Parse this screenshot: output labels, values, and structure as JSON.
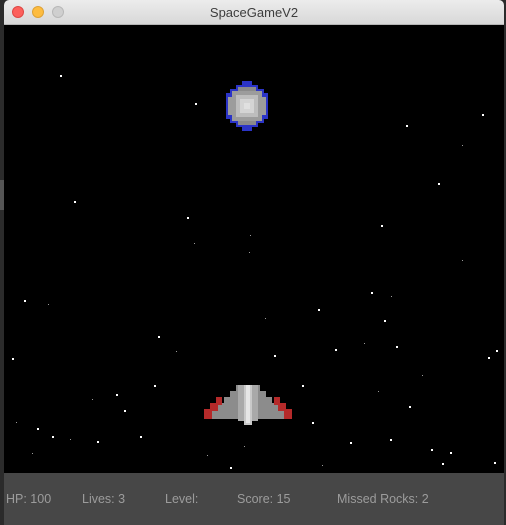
{
  "window": {
    "title": "SpaceGameV2"
  },
  "hud": {
    "hp": "HP: 100",
    "lives": "Lives: 3",
    "level": "Level:",
    "score": "Score: 15",
    "missed": "Missed Rocks: 2"
  },
  "colors": {
    "background": "#000000",
    "hud_bg": "#474747",
    "hud_text": "#9c9c9c",
    "ship_hull": "#a9a9a9",
    "ship_wing_tip": "#b52a2a",
    "rock_core": "#bdbdbd",
    "rock_edge": "#2b34c7"
  },
  "icons": {
    "player": "spaceship-icon",
    "enemy": "rock-icon"
  }
}
